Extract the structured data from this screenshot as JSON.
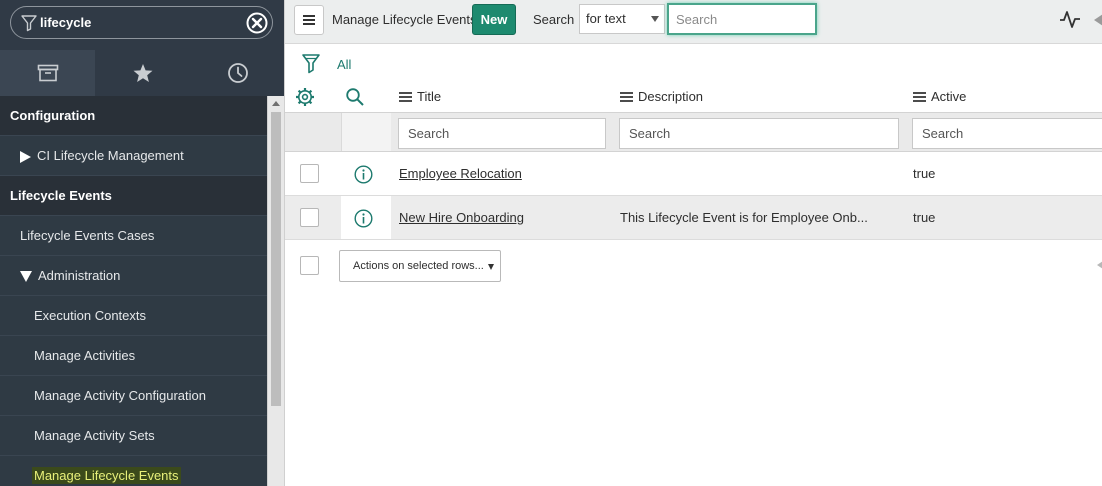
{
  "nav": {
    "filter_value": "lifecycle",
    "filter_icon": "funnel-icon",
    "clear_icon": "clear-circle-icon",
    "tabs": [
      {
        "name": "all-applications",
        "icon": "archive-box-icon"
      },
      {
        "name": "favorites",
        "icon": "star-icon"
      },
      {
        "name": "history",
        "icon": "clock-icon"
      }
    ],
    "items": [
      {
        "type": "section",
        "label": "Configuration"
      },
      {
        "type": "module",
        "label": "CI Lifecycle Management",
        "expander": "collapsed"
      },
      {
        "type": "section",
        "label": "Lifecycle Events"
      },
      {
        "type": "module",
        "label": "Lifecycle Events Cases"
      },
      {
        "type": "module",
        "label": "Administration",
        "expander": "expanded"
      },
      {
        "type": "item",
        "label": "Execution Contexts"
      },
      {
        "type": "item",
        "label": "Manage Activities"
      },
      {
        "type": "item",
        "label": "Manage Activity Configuration"
      },
      {
        "type": "item",
        "label": "Manage Activity Sets"
      },
      {
        "type": "item",
        "label": "Manage Lifecycle Events",
        "current": true
      }
    ]
  },
  "header": {
    "menu_icon": "hamburger-icon",
    "title": "Manage Lifecycle Events",
    "new_label": "New",
    "search_label": "Search",
    "search_field": "for text",
    "search_placeholder": "Search",
    "activity_icon": "activity-stream-icon"
  },
  "breadcrumb": {
    "filter_icon": "filter-funnel-icon",
    "label": "All"
  },
  "table": {
    "columns": [
      {
        "key": "title",
        "label": "Title"
      },
      {
        "key": "description",
        "label": "Description"
      },
      {
        "key": "active",
        "label": "Active"
      }
    ],
    "filter_placeholder": "Search",
    "rows": [
      {
        "title": "Employee Relocation",
        "description": "",
        "active": "true"
      },
      {
        "title": "New Hire Onboarding",
        "description": "This Lifecycle Event is for Employee Onb...",
        "active": "true"
      }
    ],
    "actions_label": "Actions on selected rows..."
  },
  "colors": {
    "nav_bg": "#303a46",
    "accent_green": "#1d8a6f",
    "link_teal": "#1d7a6e",
    "search_focus": "#4aa58b"
  }
}
